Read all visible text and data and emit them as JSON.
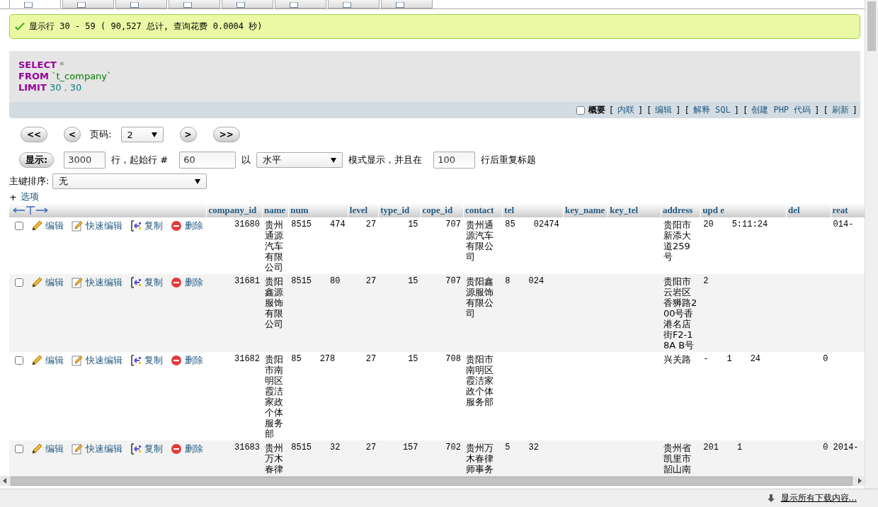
{
  "tabs": [
    {
      "selected": true
    },
    {
      "selected": false
    },
    {
      "selected": false
    },
    {
      "selected": false
    },
    {
      "selected": false
    },
    {
      "selected": false
    },
    {
      "selected": false
    },
    {
      "selected": false
    }
  ],
  "status_message": {
    "text": "显示行 30 - 59 ( 90,527 总计, 查询花费 0.0004 秒)"
  },
  "sql": [
    [
      {
        "kind": "keyword",
        "text": "SELECT"
      },
      {
        "kind": "op",
        "text": " *"
      }
    ],
    [
      {
        "kind": "keyword",
        "text": "FROM"
      },
      {
        "kind": "name",
        "text": " `t_company`"
      }
    ],
    [
      {
        "kind": "keyword",
        "text": "LIMIT"
      },
      {
        "kind": "number",
        "text": " 30"
      },
      {
        "kind": "op",
        "text": " ,"
      },
      {
        "kind": "number",
        "text": " 30"
      }
    ]
  ],
  "sql_options": {
    "profiling": {
      "label": "概要",
      "checked": false
    },
    "links": [
      {
        "before": "[",
        "label": "内联",
        "after": "]"
      },
      {
        "before": "[",
        "label": "编辑",
        "after": "]"
      },
      {
        "before": "[",
        "label": "解释 SQL",
        "after": "]"
      },
      {
        "before": "[",
        "label": "创建 PHP 代码",
        "after": "]"
      },
      {
        "before": "[",
        "label": "刷新",
        "after": "]"
      }
    ]
  },
  "pagination": {
    "first": "<<",
    "prev": "<",
    "page_label": "页码:",
    "page": "2",
    "next": ">",
    "last": ">>"
  },
  "display": {
    "button": "显示:",
    "rows": "3000",
    "text1": "行，起始行 #",
    "start": "60",
    "text2": "以",
    "mode": "水平",
    "text3": "模式显示，并且在",
    "repeat": "100",
    "text4": "行后重复标题"
  },
  "sort": {
    "label": "主键排序:",
    "value": "无"
  },
  "options_toggle": {
    "sign": "+",
    "label": "选项"
  },
  "table": {
    "columns": [
      {
        "label": "company_id"
      },
      {
        "label": "name"
      },
      {
        "label": "num"
      },
      {
        "label": "level"
      },
      {
        "label": "type_id"
      },
      {
        "label": "cope_id"
      },
      {
        "label": "contact"
      },
      {
        "label": "tel"
      },
      {
        "label": "key_name"
      },
      {
        "label": "key_tel"
      },
      {
        "label": "address"
      },
      {
        "label": "upd      e"
      },
      {
        "label": "del"
      },
      {
        "label": "reat"
      }
    ],
    "rows": [
      {
        "checked": false,
        "actions": [
          {
            "kind": "edit",
            "label": "编辑"
          },
          {
            "kind": "quick_edit",
            "label": "快速编辑"
          },
          {
            "kind": "copy",
            "label": "复制"
          },
          {
            "kind": "delete",
            "label": "删除"
          }
        ],
        "cells": [
          [
            "31680"
          ],
          [
            "贵州通源汽车有限公司"
          ],
          [
            "8515",
            "474"
          ],
          [
            "27"
          ],
          [
            "15"
          ],
          [
            "707"
          ],
          [
            "贵州通源汽车有限公司"
          ],
          [
            "85",
            "02474"
          ],
          [],
          [],
          [
            "贵阳市新添大道259号"
          ],
          [
            "20",
            "5:11:24"
          ],
          [],
          [
            "014-"
          ]
        ]
      },
      {
        "checked": false,
        "actions": [
          {
            "kind": "edit",
            "label": "编辑"
          },
          {
            "kind": "quick_edit",
            "label": "快速编辑"
          },
          {
            "kind": "copy",
            "label": "复制"
          },
          {
            "kind": "delete",
            "label": "删除"
          }
        ],
        "cells": [
          [
            "31681"
          ],
          [
            "贵阳鑫源服饰有限公司"
          ],
          [
            "8515",
            "80"
          ],
          [
            "27"
          ],
          [
            "15"
          ],
          [
            "707"
          ],
          [
            "贵阳鑫源服饰有限公司"
          ],
          [
            "8",
            "024"
          ],
          [],
          [],
          [
            "贵阳市云岩区香狮路200号香港名店街F2-18A B号"
          ],
          [
            "2"
          ],
          [],
          []
        ]
      },
      {
        "checked": false,
        "actions": [
          {
            "kind": "edit",
            "label": "编辑"
          },
          {
            "kind": "quick_edit",
            "label": "快速编辑"
          },
          {
            "kind": "copy",
            "label": "复制"
          },
          {
            "kind": "delete",
            "label": "删除"
          }
        ],
        "cells": [
          [
            "31682"
          ],
          [
            "贵阳市南明区霞洁家政个体服务部"
          ],
          [
            "85",
            "278"
          ],
          [
            "27"
          ],
          [
            "15"
          ],
          [
            "708"
          ],
          [
            "贵阳市南明区霞洁家政个体服务部"
          ],
          [],
          [],
          [],
          [
            "兴关路"
          ],
          [
            "-",
            "1",
            "24"
          ],
          [
            "0"
          ],
          []
        ]
      },
      {
        "checked": false,
        "actions": [
          {
            "kind": "edit",
            "label": "编辑"
          },
          {
            "kind": "quick_edit",
            "label": "快速编辑"
          },
          {
            "kind": "copy",
            "label": "复制"
          },
          {
            "kind": "delete",
            "label": "删除"
          }
        ],
        "cells": [
          [
            "31683"
          ],
          [
            "贵州万木春律"
          ],
          [
            "8515",
            "32"
          ],
          [
            "27"
          ],
          [
            "157"
          ],
          [
            "702"
          ],
          [
            "贵州万木春律师事务"
          ],
          [
            "5",
            "32"
          ],
          [],
          [],
          [
            "贵州省凯里市韶山南"
          ],
          [
            "201",
            "1"
          ],
          [
            "0"
          ],
          [
            "2014-"
          ]
        ]
      }
    ]
  },
  "status_bar": {
    "downloads": "显示所有下载内容..."
  }
}
